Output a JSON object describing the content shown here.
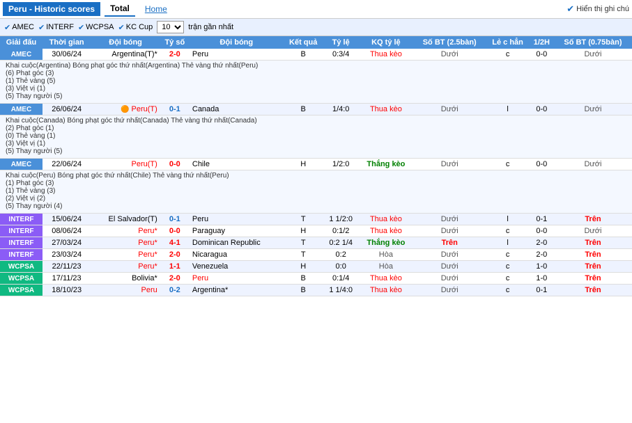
{
  "header": {
    "title": "Peru - Historic scores",
    "tabs": [
      "Total",
      "Home"
    ],
    "active_tab": "Total",
    "hien_thi": "Hiển thị ghi chú"
  },
  "filters": {
    "items": [
      "AMEC",
      "INTERF",
      "WCPSA",
      "KC Cup"
    ],
    "select_value": "10",
    "select_label": "trận gần nhất"
  },
  "columns": [
    "Giải đấu",
    "Thời gian",
    "Đội bóng",
    "Tỷ số",
    "Đội bóng",
    "Kết quả",
    "Tỷ lệ",
    "KQ tỷ lệ",
    "Số BT (2.5bàn)",
    "Lẻ c hẳn",
    "1/2H",
    "Số BT (0.75bàn)"
  ],
  "rows": [
    {
      "type": "match",
      "competition": "AMEC",
      "comp_class": "competition-amec",
      "date": "30/06/24",
      "team1": "Argentina(T)*",
      "team1_color": "normal",
      "score": "2-0",
      "score_color": "red",
      "team2": "Peru",
      "team2_color": "normal",
      "result": "B",
      "ratio": "0:3/4",
      "kq_ratio": "Thua kèo",
      "kq_class": "thua",
      "so_bt": "Dưới",
      "so_bt_class": "duoi",
      "le_chan": "c",
      "half": "0-0",
      "so_bt2": "Dưới",
      "so_bt2_class": "duoi",
      "detail_lines": [
        "Khai cuộc(Argentina)  Bóng phạt góc thứ nhất(Argentina)  Thẻ vàng thứ nhất(Peru)",
        "(6) Phạt góc (3)",
        "(1) Thẻ vàng (5)",
        "(3) Việt vị (1)",
        "(5) Thay người (5)"
      ]
    },
    {
      "type": "match",
      "competition": "AMEC",
      "comp_class": "competition-amec",
      "date": "26/06/24",
      "team1": "Peru(T)",
      "team1_color": "peru",
      "flag1": "🟠",
      "score": "0-1",
      "score_color": "blue",
      "team2": "Canada",
      "team2_color": "normal",
      "result": "B",
      "ratio": "1/4:0",
      "kq_ratio": "Thua kèo",
      "kq_class": "thua",
      "so_bt": "Dưới",
      "so_bt_class": "duoi",
      "le_chan": "l",
      "half": "0-0",
      "so_bt2": "Dưới",
      "so_bt2_class": "duoi",
      "detail_lines": [
        "Khai cuộc(Canada)  Bóng phạt góc thứ nhất(Canada)  Thẻ vàng thứ nhất(Canada)",
        "(2) Phạt góc (1)",
        "(0) Thẻ vàng (1)",
        "(3) Việt vị (1)",
        "(5) Thay người (5)"
      ]
    },
    {
      "type": "match",
      "competition": "AMEC",
      "comp_class": "competition-amec",
      "date": "22/06/24",
      "team1": "Peru(T)",
      "team1_color": "peru",
      "score": "0-0",
      "score_color": "red",
      "team2": "Chile",
      "team2_color": "normal",
      "result": "H",
      "ratio": "1/2:0",
      "kq_ratio": "Thắng kèo",
      "kq_class": "thang",
      "so_bt": "Dưới",
      "so_bt_class": "duoi",
      "le_chan": "c",
      "half": "0-0",
      "so_bt2": "Dưới",
      "so_bt2_class": "duoi",
      "detail_lines": [
        "Khai cuộc(Peru)  Bóng phạt góc thứ nhất(Chile)  Thẻ vàng thứ nhất(Peru)",
        "(1) Phạt góc (3)",
        "(1) Thẻ vàng (3)",
        "(2) Việt vị (2)",
        "(5) Thay người (4)"
      ]
    },
    {
      "type": "match",
      "competition": "INTERF",
      "comp_class": "competition-interf",
      "date": "15/06/24",
      "team1": "El Salvador(T)",
      "team1_color": "normal",
      "score": "0-1",
      "score_color": "blue",
      "team2": "Peru",
      "team2_color": "normal",
      "result": "T",
      "ratio": "1 1/2:0",
      "kq_ratio": "Thua kèo",
      "kq_class": "thua",
      "so_bt": "Dưới",
      "so_bt_class": "duoi",
      "le_chan": "l",
      "half": "0-1",
      "so_bt2": "Trên",
      "so_bt2_class": "tren",
      "detail_lines": []
    },
    {
      "type": "match",
      "competition": "INTERF",
      "comp_class": "competition-interf",
      "date": "08/06/24",
      "team1": "Peru*",
      "team1_color": "peru",
      "score": "0-0",
      "score_color": "red",
      "team2": "Paraguay",
      "team2_color": "normal",
      "result": "H",
      "ratio": "0:1/2",
      "kq_ratio": "Thua kèo",
      "kq_class": "thua",
      "so_bt": "Dưới",
      "so_bt_class": "duoi",
      "le_chan": "c",
      "half": "0-0",
      "so_bt2": "Dưới",
      "so_bt2_class": "duoi",
      "detail_lines": []
    },
    {
      "type": "match",
      "competition": "INTERF",
      "comp_class": "competition-interf",
      "date": "27/03/24",
      "team1": "Peru*",
      "team1_color": "peru",
      "score": "4-1",
      "score_color": "red",
      "team2": "Dominican Republic",
      "team2_color": "normal",
      "result": "T",
      "ratio": "0:2 1/4",
      "kq_ratio": "Thắng kèo",
      "kq_class": "thang",
      "so_bt": "Trên",
      "so_bt_class": "tren",
      "le_chan": "l",
      "half": "2-0",
      "so_bt2": "Trên",
      "so_bt2_class": "tren",
      "detail_lines": []
    },
    {
      "type": "match",
      "competition": "INTERF",
      "comp_class": "competition-interf",
      "date": "23/03/24",
      "team1": "Peru*",
      "team1_color": "peru",
      "score": "2-0",
      "score_color": "red",
      "team2": "Nicaragua",
      "team2_color": "normal",
      "result": "T",
      "ratio": "0:2",
      "kq_ratio": "Hòa",
      "kq_class": "hoa",
      "so_bt": "Dưới",
      "so_bt_class": "duoi",
      "le_chan": "c",
      "half": "2-0",
      "so_bt2": "Trên",
      "so_bt2_class": "tren",
      "detail_lines": []
    },
    {
      "type": "match",
      "competition": "WCPSA",
      "comp_class": "competition-wcpsa",
      "date": "22/11/23",
      "team1": "Peru*",
      "team1_color": "peru",
      "score": "1-1",
      "score_color": "red",
      "team2": "Venezuela",
      "team2_color": "normal",
      "result": "H",
      "ratio": "0:0",
      "kq_ratio": "Hòa",
      "kq_class": "hoa",
      "so_bt": "Dưới",
      "so_bt_class": "duoi",
      "le_chan": "c",
      "half": "1-0",
      "so_bt2": "Trên",
      "so_bt2_class": "tren",
      "detail_lines": []
    },
    {
      "type": "match",
      "competition": "WCPSA",
      "comp_class": "competition-wcpsa",
      "date": "17/11/23",
      "team1": "Bolivia*",
      "team1_color": "normal",
      "score": "2-0",
      "score_color": "red",
      "team2": "Peru",
      "team2_color": "peru",
      "result": "B",
      "ratio": "0:1/4",
      "kq_ratio": "Thua kèo",
      "kq_class": "thua",
      "so_bt": "Dưới",
      "so_bt_class": "duoi",
      "le_chan": "c",
      "half": "1-0",
      "so_bt2": "Trên",
      "so_bt2_class": "tren",
      "detail_lines": []
    },
    {
      "type": "match",
      "competition": "WCPSA",
      "comp_class": "competition-wcpsa",
      "date": "18/10/23",
      "team1": "Peru",
      "team1_color": "peru",
      "score": "0-2",
      "score_color": "blue",
      "team2": "Argentina*",
      "team2_color": "normal",
      "result": "B",
      "ratio": "1 1/4:0",
      "kq_ratio": "Thua kèo",
      "kq_class": "thua",
      "so_bt": "Dưới",
      "so_bt_class": "duoi",
      "le_chan": "c",
      "half": "0-1",
      "so_bt2": "Trên",
      "so_bt2_class": "tren",
      "detail_lines": []
    }
  ]
}
